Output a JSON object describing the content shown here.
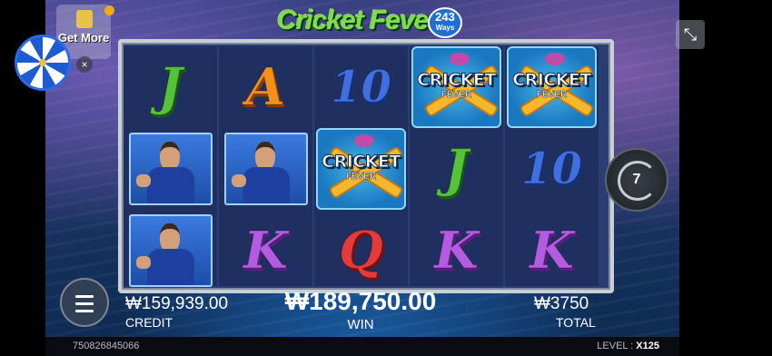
{
  "logo": {
    "text": "Cricket Fever",
    "ways_number": "243",
    "ways_label": "Ways"
  },
  "sidebar": {
    "get_more_label": "Get More",
    "close_glyph": "×"
  },
  "controls": {
    "collapse_glyph": "⤡",
    "spin_count": "7"
  },
  "reels": {
    "columns": [
      [
        "J",
        "player",
        "player"
      ],
      [
        "A",
        "player",
        "K"
      ],
      [
        "10",
        "wild",
        "Q"
      ],
      [
        "wild",
        "J",
        "K"
      ],
      [
        "wild",
        "10",
        "K"
      ]
    ],
    "wild_line1": "CRICKET",
    "wild_line2": "FEVER"
  },
  "stats": {
    "credit_value": "₩159,939.00",
    "credit_label": "CREDIT",
    "win_value": "₩189,750.00",
    "win_label": "WIN",
    "total_value": "₩3750",
    "total_label": "TOTAL"
  },
  "footer": {
    "round_id": "750826845066",
    "level_label": "LEVEL :",
    "level_value": "X125"
  },
  "icons": [
    "gift-icon",
    "wheel-icon",
    "close-icon",
    "collapse-icon",
    "spin-icon",
    "menu-icon"
  ]
}
